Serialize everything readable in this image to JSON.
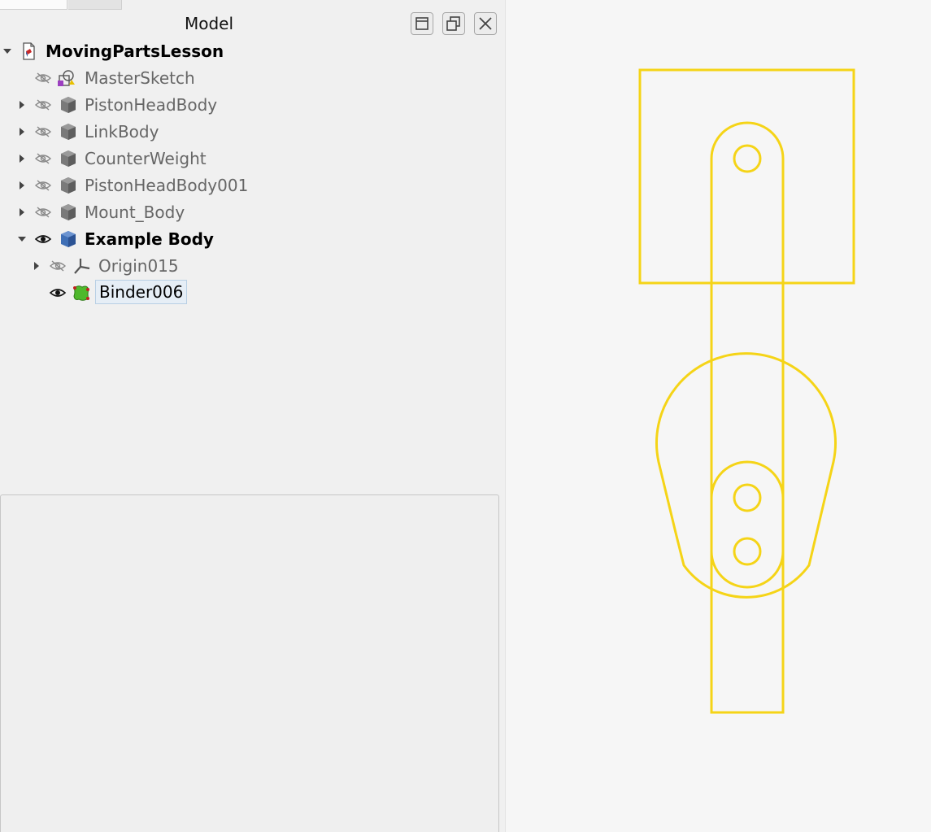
{
  "panel": {
    "title": "Model"
  },
  "tree": {
    "root": {
      "label": "MovingPartsLesson",
      "icon": "document-icon"
    },
    "items": [
      {
        "label": "MasterSketch",
        "icon": "sketch-icon",
        "visible": false,
        "expandable": false
      },
      {
        "label": "PistonHeadBody",
        "icon": "body-icon",
        "visible": false,
        "expandable": true
      },
      {
        "label": "LinkBody",
        "icon": "body-icon",
        "visible": false,
        "expandable": true
      },
      {
        "label": "CounterWeight",
        "icon": "body-icon",
        "visible": false,
        "expandable": true
      },
      {
        "label": "PistonHeadBody001",
        "icon": "body-icon",
        "visible": false,
        "expandable": true
      },
      {
        "label": "Mount_Body",
        "icon": "body-icon",
        "visible": false,
        "expandable": true
      },
      {
        "label": "Example Body",
        "icon": "active-body-icon",
        "visible": true,
        "expandable": true,
        "expanded": true
      },
      {
        "label": "Origin015",
        "icon": "origin-icon",
        "visible": false,
        "expandable": true
      },
      {
        "label": "Binder006",
        "icon": "shape-binder-icon",
        "visible": true,
        "expandable": false,
        "selected": true
      }
    ]
  },
  "colors": {
    "sketch_line": "#f5d417",
    "viewport_bg": "#f6f6f6",
    "panel_bg": "#f0f0f0"
  }
}
